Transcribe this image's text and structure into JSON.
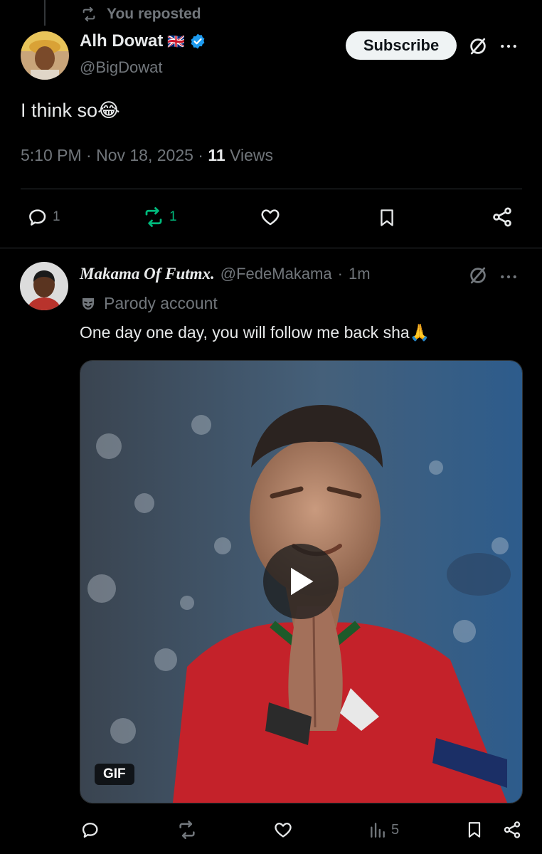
{
  "repost_header": {
    "text": "You reposted"
  },
  "main_tweet": {
    "author_name": "Alh Dowat",
    "flag": "🇬🇧",
    "handle": "@BigDowat",
    "subscribe_label": "Subscribe",
    "text": "I think so",
    "emoji": "😂",
    "time": "5:10 PM · Nov 18, 2025 · ",
    "views_count": "11",
    "views_label": " Views",
    "actions": {
      "reply_count": "1",
      "repost_count": "1"
    }
  },
  "reply_tweet": {
    "author_name": "Makama Of Futmx.",
    "handle": "@FedeMakama",
    "sep": "·",
    "time": "1m",
    "parody_label": "Parody account",
    "text": "One day one day, you will follow me back sha",
    "emoji": "🙏",
    "media_badge": "GIF",
    "actions": {
      "views_count": "5"
    }
  },
  "colors": {
    "background": "#000000",
    "accent_blue": "#1d9bf0",
    "repost_green": "#00ba7c",
    "muted": "#71767b"
  },
  "icons": [
    "repost-icon",
    "verified-badge-icon",
    "grok-icon",
    "more-icon",
    "reply-icon",
    "like-icon",
    "bookmark-icon",
    "share-icon",
    "views-icon",
    "play-icon",
    "parody-mask-icon"
  ]
}
